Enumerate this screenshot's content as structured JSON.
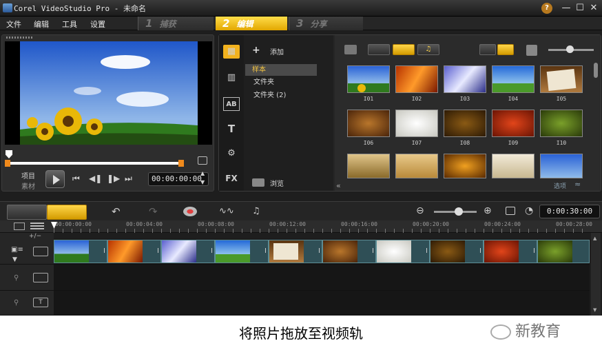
{
  "window": {
    "title": "Corel VideoStudio Pro - 未命名"
  },
  "menu": {
    "items": [
      "文件",
      "编辑",
      "工具",
      "设置"
    ]
  },
  "steps": [
    {
      "num": "1",
      "label": "捕获"
    },
    {
      "num": "2",
      "label": "编辑"
    },
    {
      "num": "3",
      "label": "分享"
    }
  ],
  "preview": {
    "project_label": "项目",
    "clip_label": "素材",
    "timecode": "00:00:00:00"
  },
  "library": {
    "add_label": "添加",
    "folders": [
      "样本",
      "文件夹",
      "文件夹 (2)"
    ],
    "browse_label": "浏览",
    "options_label": "选项",
    "thumbnails": [
      "I01",
      "I02",
      "I03",
      "I04",
      "I05",
      "I06",
      "I07",
      "I08",
      "I09",
      "I10"
    ]
  },
  "timeline": {
    "duration": "0:00:30:00",
    "ruler": [
      "00:00:00:00",
      "00:00:04:00",
      "00:00:08:00",
      "00:00:12:00",
      "00:00:16:00",
      "00:00:20:00",
      "00:00:24:00",
      "00:00:28:00"
    ],
    "transition_marker": "I"
  },
  "caption": "将照片拖放至视频轨",
  "watermark": "新教育"
}
